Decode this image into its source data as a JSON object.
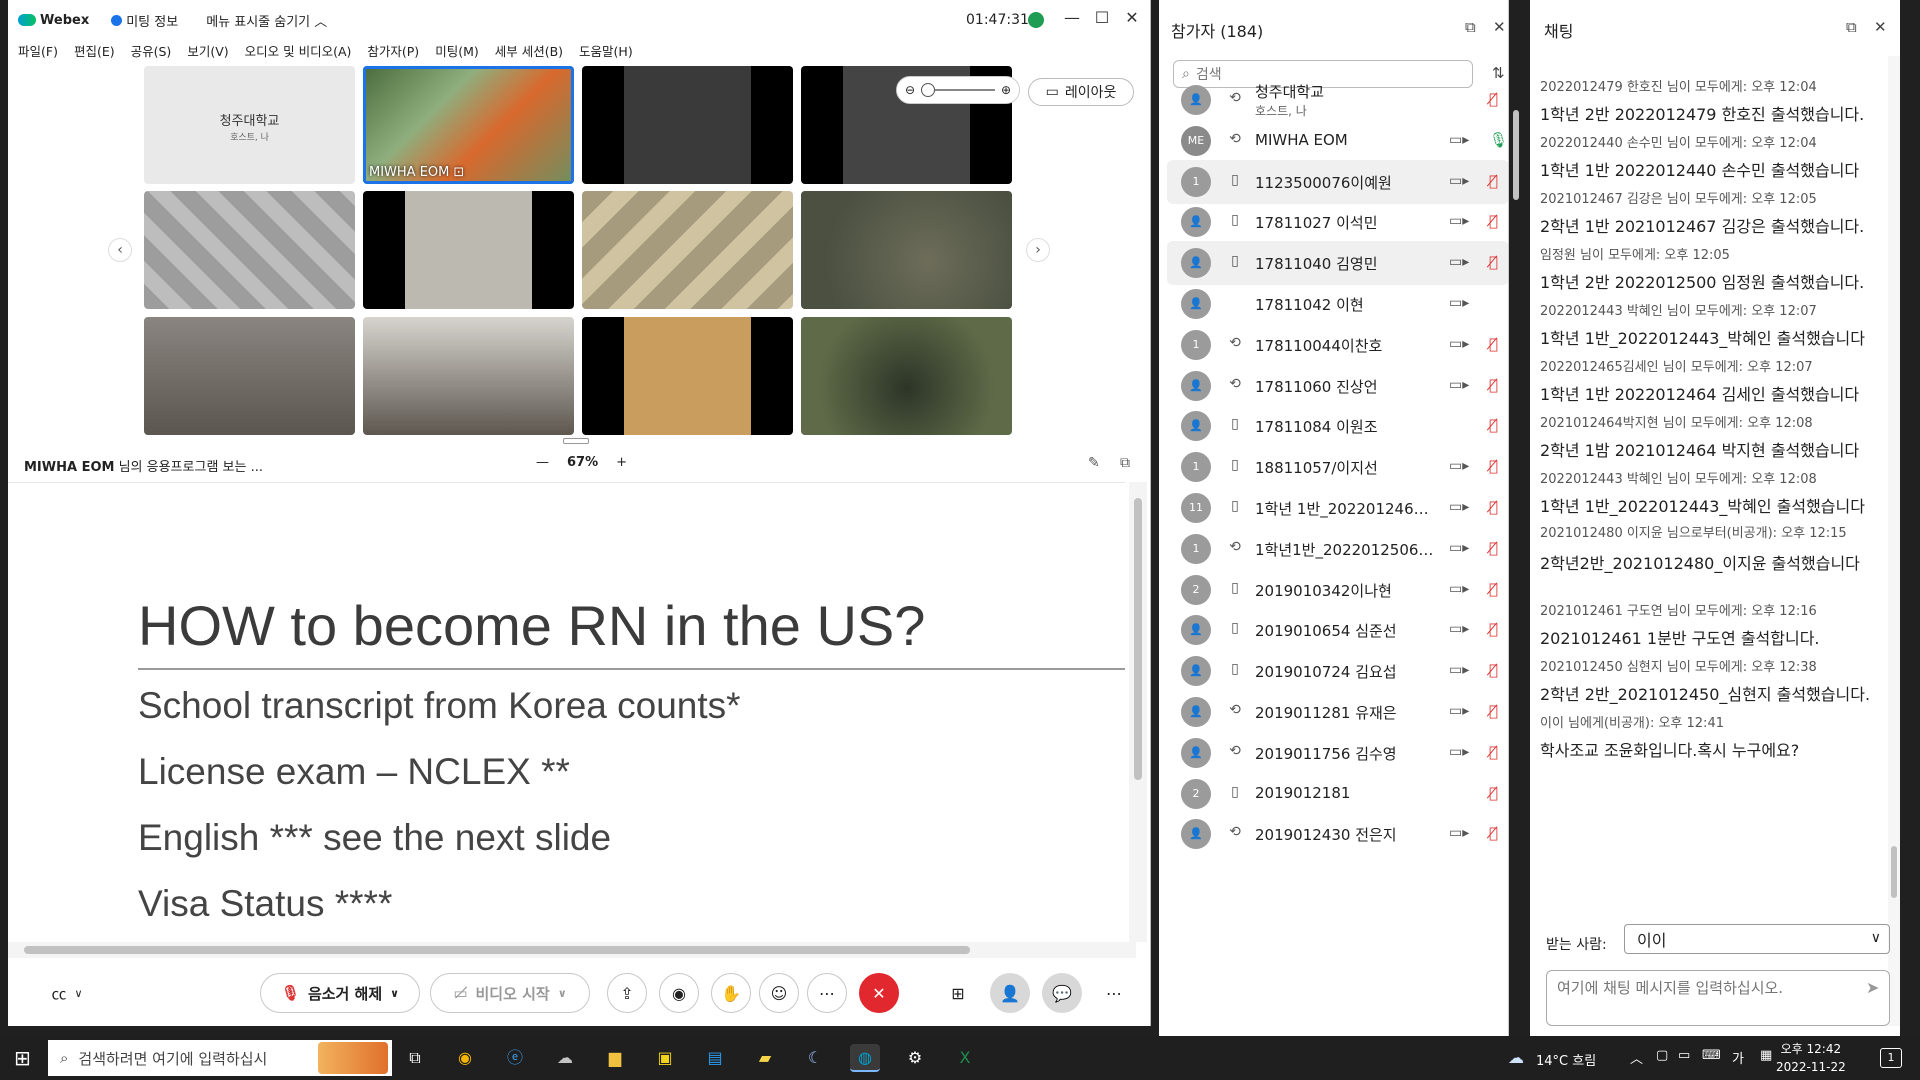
{
  "window": {
    "app_name": "Webex",
    "meeting_info": "미팅 정보",
    "hide_menu": "메뉴 표시줄 숨기기",
    "clock": "01:47:31"
  },
  "menu": [
    "파일(F)",
    "편집(E)",
    "공유(S)",
    "보기(V)",
    "오디오 및 비디오(A)",
    "참가자(P)",
    "미팅(M)",
    "세부 세션(B)",
    "도움말(H)"
  ],
  "grid": {
    "host_tile_name": "청주대학교",
    "host_tile_sub": "호스트, 나",
    "active_speaker": "MIWHA EOM",
    "layout_label": "레이아웃"
  },
  "share": {
    "owner": "MIWHA EOM",
    "owner_suffix": " 님의 응용프로그램 보는 ...",
    "zoom": "67%"
  },
  "slide": {
    "title": "HOW to become RN in the US?",
    "bullets": [
      "School transcript from Korea counts*",
      "License exam – NCLEX **",
      "English *** see the next slide",
      "Visa Status ****"
    ]
  },
  "controls": {
    "unmute": "음소거 해제",
    "start_video": "비디오 시작"
  },
  "participants": {
    "title": "참가자 (184)",
    "search_placeholder": "검색",
    "rows": [
      {
        "avatar": "",
        "name": "청주대학교",
        "sub": "호스트, 나",
        "device": "sync",
        "video": false,
        "mic": "muted"
      },
      {
        "avatar": "ME",
        "name": "MIWHA EOM",
        "sub": "",
        "device": "sync",
        "video": true,
        "mic": "live"
      },
      {
        "avatar": "1",
        "name": "1123500076이예원",
        "sub": "",
        "device": "phone",
        "video": true,
        "mic": "muted",
        "hl": true
      },
      {
        "avatar": "",
        "name": "17811027 이석민",
        "sub": "",
        "device": "phone",
        "video": true,
        "mic": "muted"
      },
      {
        "avatar": "",
        "name": "17811040 김영민",
        "sub": "",
        "device": "phone",
        "video": true,
        "mic": "muted",
        "hl": true
      },
      {
        "avatar": "",
        "name": "17811042 이현",
        "sub": "",
        "device": "",
        "video": true,
        "mic": ""
      },
      {
        "avatar": "1",
        "name": "178110044이찬호",
        "sub": "",
        "device": "sync",
        "video": true,
        "mic": "muted"
      },
      {
        "avatar": "",
        "name": "17811060 진상언",
        "sub": "",
        "device": "sync",
        "video": true,
        "mic": "muted"
      },
      {
        "avatar": "",
        "name": "17811084 이원조",
        "sub": "",
        "device": "phone",
        "video": false,
        "mic": "muted"
      },
      {
        "avatar": "1",
        "name": "18811057/이지선",
        "sub": "",
        "device": "phone",
        "video": true,
        "mic": "muted"
      },
      {
        "avatar": "11",
        "name": "1학년 1반_2022012467...",
        "sub": "",
        "device": "phone",
        "video": true,
        "mic": "muted"
      },
      {
        "avatar": "1",
        "name": "1학년1반_2022012506_...",
        "sub": "",
        "device": "sync",
        "video": true,
        "mic": "muted"
      },
      {
        "avatar": "2",
        "name": "2019010342이나현",
        "sub": "",
        "device": "phone",
        "video": true,
        "mic": "muted"
      },
      {
        "avatar": "",
        "name": "2019010654 심준선",
        "sub": "",
        "device": "phone",
        "video": true,
        "mic": "muted"
      },
      {
        "avatar": "",
        "name": "2019010724 김요섭",
        "sub": "",
        "device": "phone",
        "video": true,
        "mic": "muted"
      },
      {
        "avatar": "",
        "name": "2019011281 유재은",
        "sub": "",
        "device": "sync",
        "video": true,
        "mic": "muted"
      },
      {
        "avatar": "",
        "name": "2019011756 김수영",
        "sub": "",
        "device": "sync",
        "video": true,
        "mic": "muted"
      },
      {
        "avatar": "2",
        "name": "2019012181",
        "sub": "",
        "device": "phone",
        "video": false,
        "mic": "muted"
      },
      {
        "avatar": "",
        "name": "2019012430 전은지",
        "sub": "",
        "device": "sync",
        "video": true,
        "mic": "muted"
      }
    ]
  },
  "chat": {
    "title": "채팅",
    "messages": [
      {
        "meta": "2022012479 한호진 님이 모두에게:   오후 12:04",
        "body": "1학년 2반 2022012479 한호진 출석했습니다."
      },
      {
        "meta": "2022012440 손수민 님이 모두에게:   오후 12:04",
        "body": "1학년 1반 2022012440 손수민 출석했습니다"
      },
      {
        "meta": "2021012467 김강은 님이 모두에게:   오후 12:05",
        "body": "2학년 1반 2021012467 김강은 출석했습니다."
      },
      {
        "meta": "임정원 님이 모두에게:   오후 12:05",
        "body": "1학년 2반 2022012500 임정원 출석했습니다."
      },
      {
        "meta": "2022012443 박혜인 님이 모두에게:   오후 12:07",
        "body": "1학년 1반_2022012443_박혜인 출석했습니다"
      },
      {
        "meta": "2022012465김세인 님이 모두에게:   오후 12:07",
        "body": "1학년 1반 2022012464 김세인 출석했습니다"
      },
      {
        "meta": "2021012464박지현 님이 모두에게:   오후 12:08",
        "body": "2학년 1밤 2021012464 박지현 출석했습니다"
      },
      {
        "meta": "2022012443 박혜인 님이 모두에게:   오후 12:08",
        "body": "1학년 1반_2022012443_박혜인 출석했습니다"
      },
      {
        "meta": "2021012480 이지윤 님으로부터(비공개):   오후 12:15",
        "body": "2학년2반_2021012480_이지윤 출석했습니다",
        "wrap": true
      },
      {
        "meta": "2021012461 구도연 님이 모두에게:   오후 12:16",
        "body": "2021012461 1분반 구도연 출석합니다."
      },
      {
        "meta": "2021012450 심현지 님이 모두에게:   오후 12:38",
        "body": "2학년 2반_2021012450_심현지 출석했습니다."
      },
      {
        "meta": "이이 님에게(비공개):   오후 12:41",
        "body": "학사조교 조윤화입니다.혹시 누구에요?"
      }
    ],
    "to_label": "받는 사람:",
    "to_value": "이이",
    "input_placeholder": "여기에 채팅 메시지를 입력하십시오."
  },
  "taskbar": {
    "search_placeholder": "검색하려면 여기에 입력하십시",
    "weather": "14°C 흐림",
    "ime": "가",
    "time": "오후 12:42",
    "date": "2022-11-22",
    "notif_count": "1"
  },
  "colors": {
    "accent": "#1c73e8",
    "end_call": "#e0282e",
    "mic_muted": "#d33333",
    "mic_live": "#1f9d55"
  }
}
